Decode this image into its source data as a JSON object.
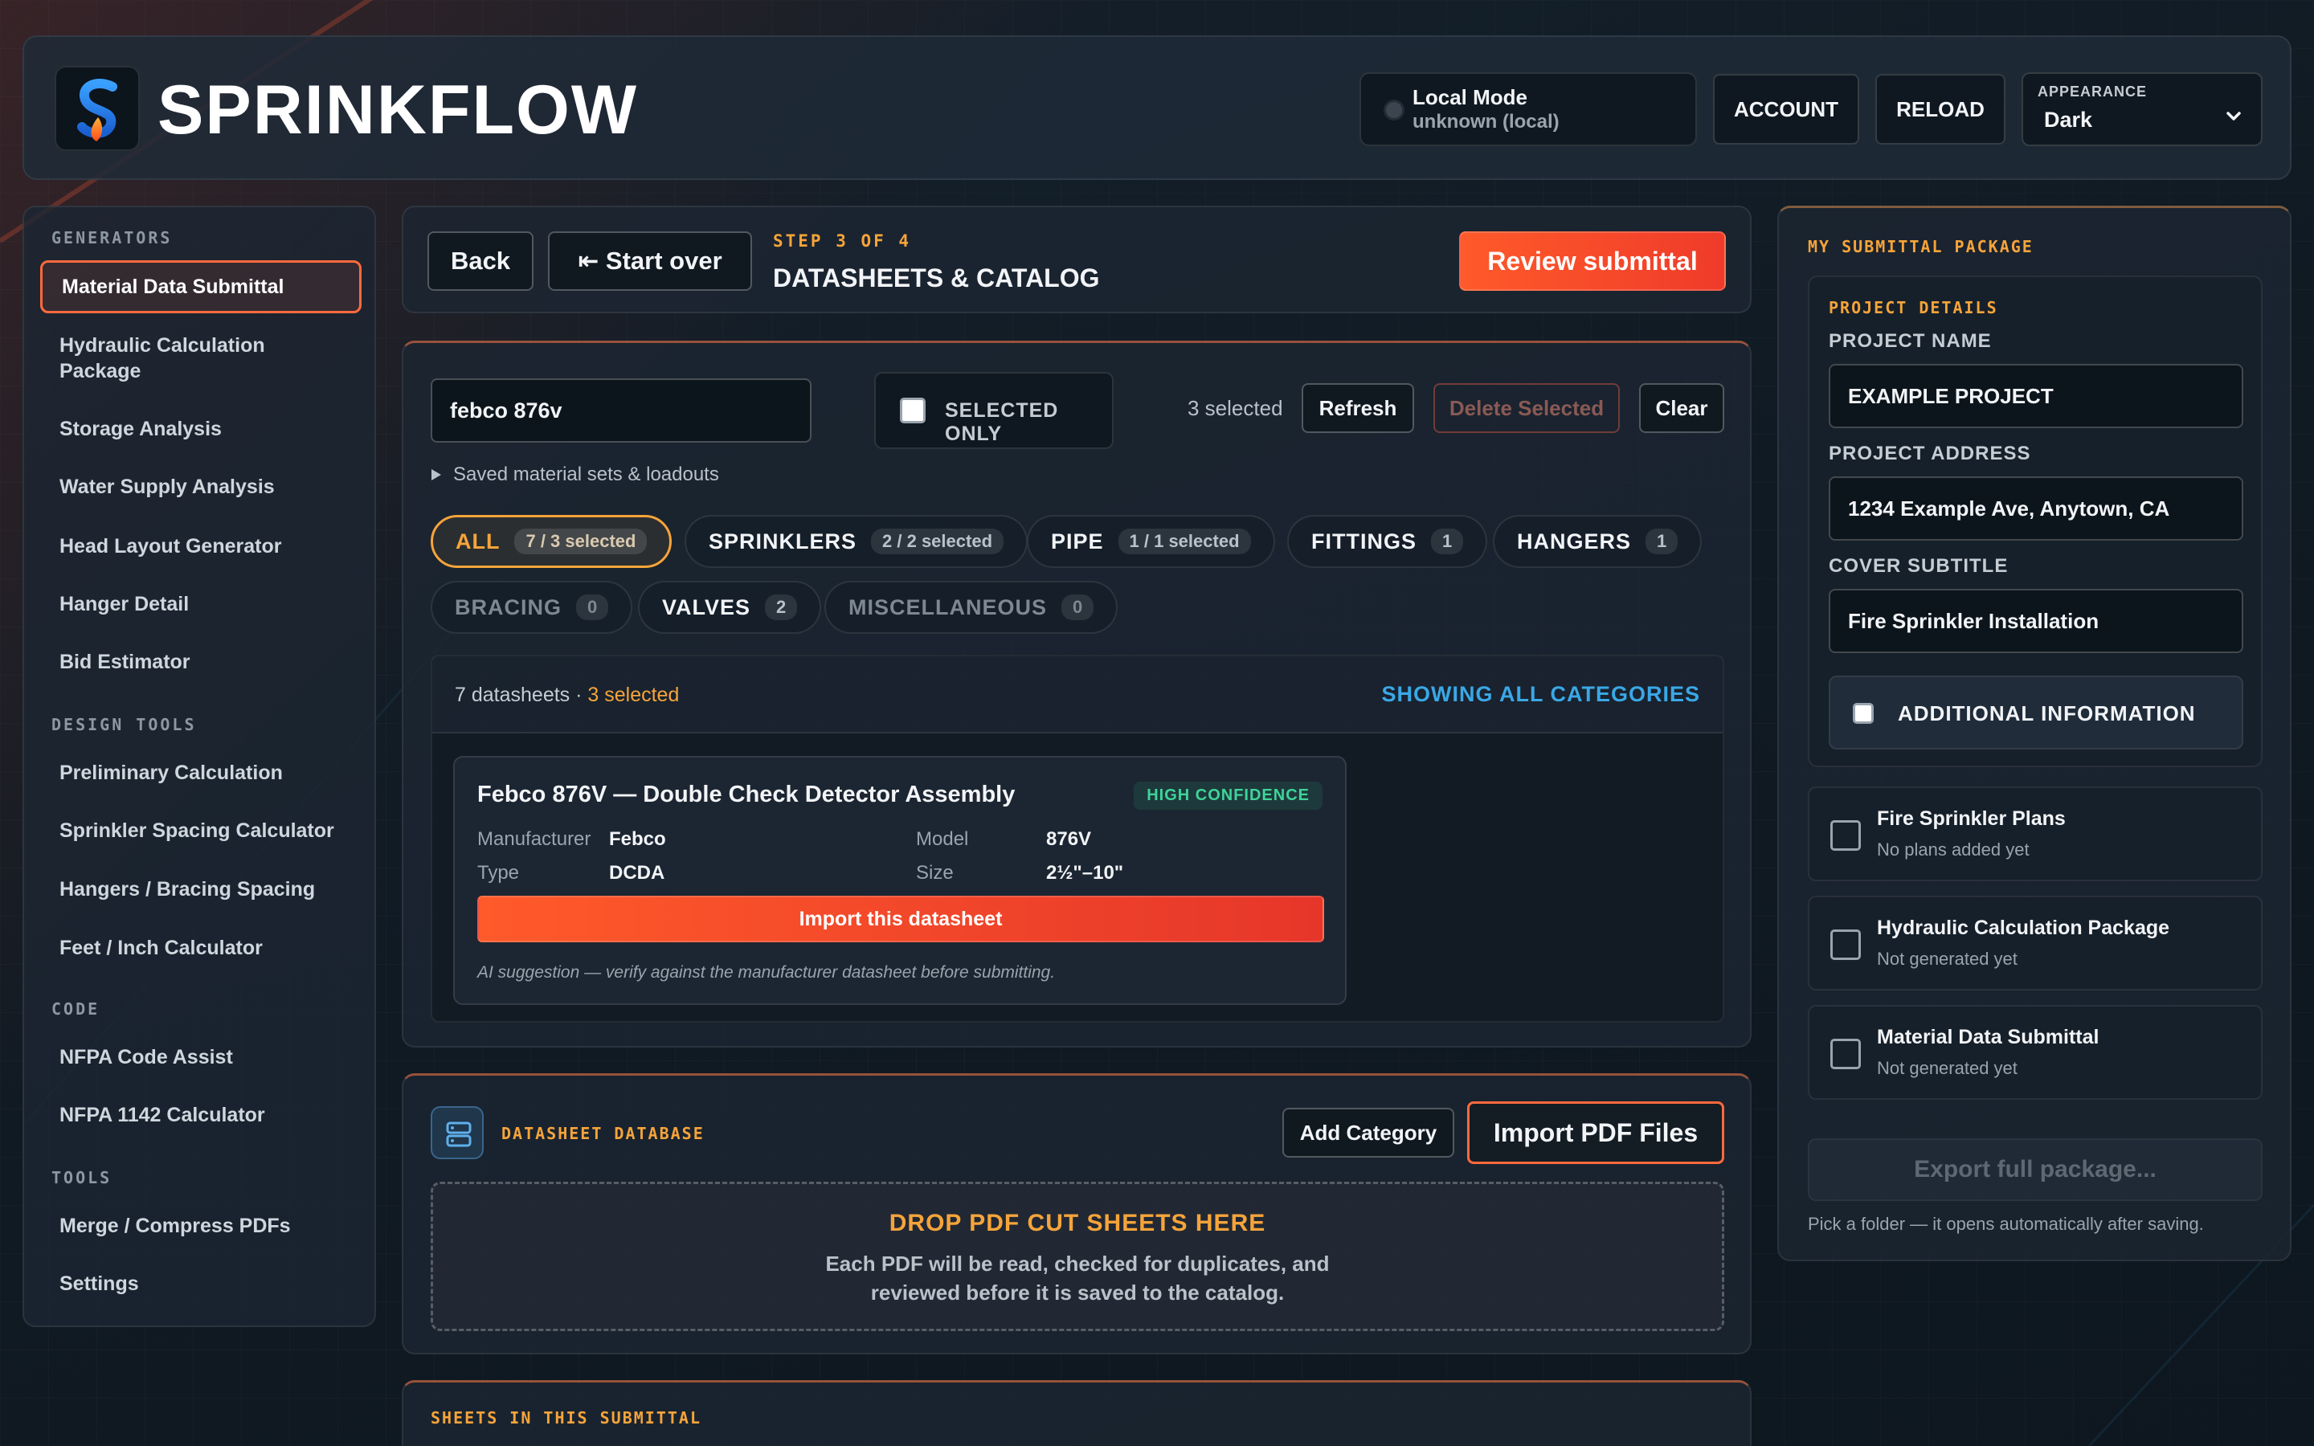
{
  "app": {
    "brand": "SPRINKFLOW",
    "mode_title": "Local Mode",
    "mode_sub": "unknown (local)",
    "account_label": "ACCOUNT",
    "reload_label": "RELOAD",
    "appearance_label": "APPEARANCE",
    "appearance_value": "Dark",
    "accent": "#ff5a2a",
    "highlight": "#f6a43a"
  },
  "sidebar": {
    "sections": [
      {
        "title": "GENERATORS",
        "items": [
          "Material Data Submittal",
          "Hydraulic Calculation Package",
          "Storage Analysis",
          "Water Supply Analysis",
          "Head Layout Generator",
          "Hanger Detail",
          "Bid Estimator"
        ]
      },
      {
        "title": "DESIGN TOOLS",
        "items": [
          "Preliminary Calculation",
          "Sprinkler Spacing Calculator",
          "Hangers / Bracing Spacing",
          "Feet / Inch Calculator"
        ]
      },
      {
        "title": "CODE",
        "items": [
          "NFPA Code Assist",
          "NFPA 1142 Calculator"
        ]
      },
      {
        "title": "TOOLS",
        "items": [
          "Merge / Compress PDFs",
          "Settings"
        ]
      }
    ],
    "hydraulic_line1": "Hydraulic Calculation",
    "hydraulic_line2": "Package"
  },
  "stepbar": {
    "back_label": "Back",
    "start_over_label": "⇤ Start over",
    "step_label": "STEP 3 OF 4",
    "title": "DATASHEETS & CATALOG",
    "review_label": "Review submittal"
  },
  "selection": {
    "search_value": "febco 876v",
    "selected_only_label": "SELECTED ONLY",
    "selected_count": "3 selected",
    "refresh_label": "Refresh",
    "delete_label": "Delete Selected",
    "clear_label": "Clear",
    "saved_sets_label": "Saved material sets & loadouts",
    "categories": [
      {
        "label": "ALL",
        "badge": "7 / 3 selected"
      },
      {
        "label": "SPRINKLERS",
        "badge": "2 / 2 selected"
      },
      {
        "label": "PIPE",
        "badge": "1 / 1 selected"
      },
      {
        "label": "FITTINGS",
        "badge": "1"
      },
      {
        "label": "HANGERS",
        "badge": "1"
      },
      {
        "label": "BRACING",
        "badge": "0"
      },
      {
        "label": "VALVES",
        "badge": "2"
      },
      {
        "label": "MISCELLANEOUS",
        "badge": "0"
      }
    ],
    "results_count": "7 datasheets",
    "results_sep": " · ",
    "results_selected": "3 selected",
    "showing_label": "SHOWING ALL CATEGORIES"
  },
  "suggestion": {
    "title": "Febco 876V — Double Check Detector Assembly",
    "confidence": "HIGH CONFIDENCE",
    "manufacturer_label": "Manufacturer",
    "manufacturer": "Febco",
    "model_label": "Model",
    "model": "876V",
    "type_label": "Type",
    "type": "DCDA",
    "size_label": "Size",
    "size": "2½\"–10\"",
    "import_label": "Import this datasheet",
    "note": "AI suggestion — verify against the manufacturer datasheet before submitting."
  },
  "database": {
    "title": "DATASHEET DATABASE",
    "add_category_label": "Add Category",
    "import_pdf_label": "Import PDF Files",
    "drop_title": "DROP PDF CUT SHEETS HERE",
    "drop_line1": "Each PDF will be read, checked for duplicates, and",
    "drop_line2": "reviewed before it is saved to the catalog."
  },
  "sheets": {
    "title": "SHEETS IN THIS SUBMITTAL"
  },
  "package": {
    "title": "MY SUBMITTAL PACKAGE",
    "details_title": "PROJECT DETAILS",
    "project_name_label": "PROJECT NAME",
    "project_name": "EXAMPLE PROJECT",
    "project_address_label": "PROJECT ADDRESS",
    "project_address": "1234 Example Ave, Anytown, CA",
    "cover_subtitle_label": "COVER SUBTITLE",
    "cover_subtitle": "Fire Sprinkler Installation",
    "additional_label": "ADDITIONAL INFORMATION",
    "items": [
      {
        "title": "Fire Sprinkler Plans",
        "status": "No plans added yet"
      },
      {
        "title": "Hydraulic Calculation Package",
        "status": "Not generated yet"
      },
      {
        "title": "Material Data Submittal",
        "status": "Not generated yet"
      }
    ],
    "export_label": "Export full package...",
    "export_hint": "Pick a folder — it opens automatically after saving."
  },
  "icons": [
    "sprinkflow-logo-icon",
    "chevron-down-icon",
    "caret-right-icon",
    "database-icon",
    "status-dot-icon"
  ]
}
